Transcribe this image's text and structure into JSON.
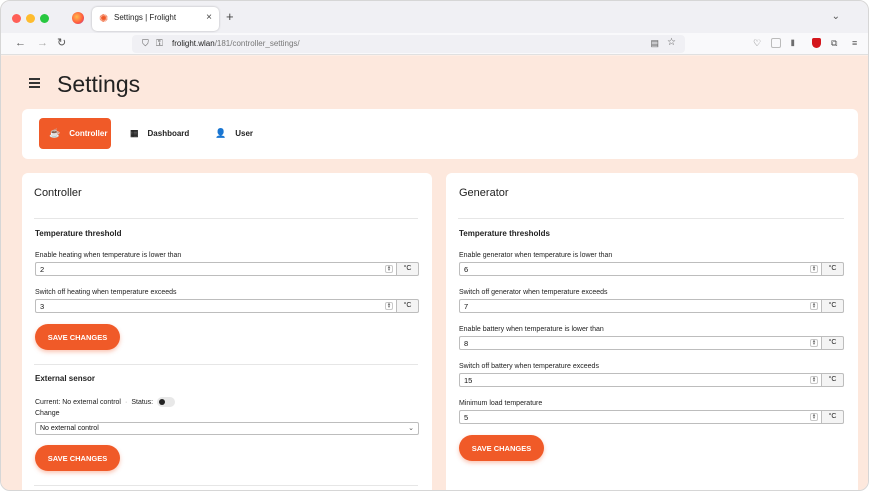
{
  "browser": {
    "tab_title": "Settings | Frolight",
    "url_host": "frolight.wlan",
    "url_path": "/181/controller_settings/"
  },
  "page": {
    "title": "Settings"
  },
  "nav": {
    "controller": "Controller",
    "dashboard": "Dashboard",
    "user": "User",
    "active": "Controller"
  },
  "controller": {
    "title": "Controller",
    "threshold_title": "Temperature threshold",
    "heating_label": "Enable heating when temperature is lower than",
    "heating_value": "2",
    "switchoff_label": "Switch off heating when temperature exceeds",
    "switchoff_value": "3",
    "unit": "°C",
    "save_label": "SAVE CHANGES",
    "external_title": "External sensor",
    "current_text": "Current: No external control",
    "status_label": "Status:",
    "change_label": "Change",
    "select_value": "No external control",
    "save_label_2": "SAVE CHANGES"
  },
  "generator": {
    "title": "Generator",
    "threshold_title": "Temperature thresholds",
    "fields": [
      {
        "label": "Enable generator when temperature is lower than",
        "value": "6"
      },
      {
        "label": "Switch off generator when temperature exceeds",
        "value": "7"
      },
      {
        "label": "Enable battery when temperature is lower than",
        "value": "8"
      },
      {
        "label": "Switch off battery when temperature exceeds",
        "value": "15"
      },
      {
        "label": "Minimum load temperature",
        "value": "5"
      }
    ],
    "unit": "°C",
    "save_label": "SAVE CHANGES"
  },
  "colors": {
    "accent": "#f05a28",
    "page_bg": "#fde8dd"
  }
}
